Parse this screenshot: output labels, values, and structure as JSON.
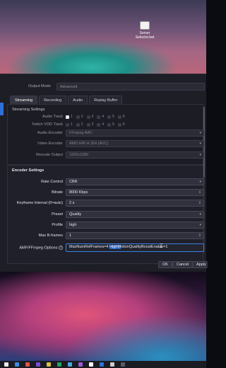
{
  "desktop": {
    "icon_label": "Server\nSelector.bat"
  },
  "window": {
    "output_mode_label": "Output Mode",
    "output_mode_value": "Advanced",
    "tabs": [
      "Streaming",
      "Recording",
      "Audio",
      "Replay Buffer"
    ],
    "streaming": {
      "title": "Streaming Settings",
      "audio_track_label": "Audio Track",
      "twitch_vod_label": "Twitch VOD Track",
      "tracks": [
        "1",
        "2",
        "3",
        "4",
        "5",
        "6"
      ],
      "audio_encoder_label": "Audio Encoder",
      "audio_encoder_value": "FFmpeg AAC",
      "video_encoder_label": "Video Encoder",
      "video_encoder_value": "AMD HW H.264 (AVC)",
      "rescale_label": "Rescale Output",
      "rescale_value": "1920x1080"
    },
    "encoder": {
      "title": "Encoder Settings",
      "rate_control_label": "Rate Control",
      "rate_control_value": "CBR",
      "bitrate_label": "Bitrate",
      "bitrate_value": "8000 Kbps",
      "keyframe_label": "Keyframe Interval (0=auto)",
      "keyframe_value": "2 s",
      "preset_label": "Preset",
      "preset_value": "Quality",
      "profile_label": "Profile",
      "profile_value": "high",
      "bframes_label": "Max B-frames",
      "bframes_value": "1",
      "amf_label": "AMF/FFmpeg Options",
      "amf_value_pre": "MaxNumRefFrames=4 ",
      "amf_value_hl": "HighM",
      "amf_value_post": "otionQualityBoostEnable=1"
    },
    "buttons": {
      "ok": "OK",
      "cancel": "Cancel",
      "apply": "Apply"
    }
  }
}
